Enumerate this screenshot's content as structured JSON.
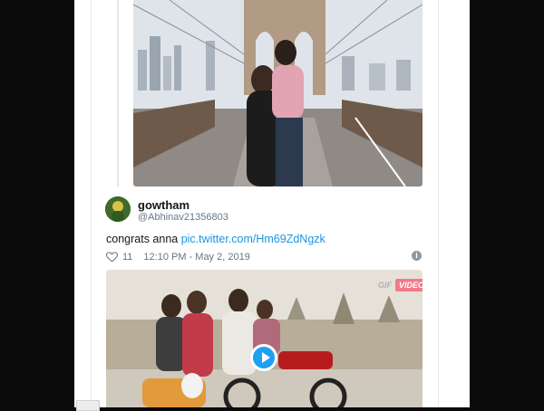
{
  "tweet": {
    "display_name": "gowtham",
    "handle": "@Abhinav21356803",
    "text": "congrats anna ",
    "link": "pic.twitter.com/Hm69ZdNgzk",
    "like_count": "11",
    "timestamp": "12:10 PM - May 2, 2019"
  },
  "gif": {
    "badge_left": "GIF",
    "badge_right": "VIDEO"
  },
  "icons": {
    "like": "heart-icon",
    "info": "info-icon",
    "play": "play-icon"
  },
  "colors": {
    "link": "#1b95e0",
    "play": "#1da1f2",
    "text": "#14171a",
    "muted": "#657786"
  }
}
